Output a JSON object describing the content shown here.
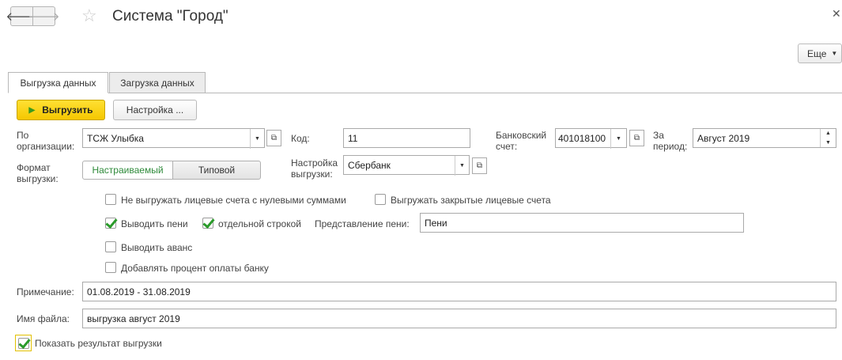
{
  "window": {
    "title": "Система \"Город\""
  },
  "header": {
    "more_label": "Еще"
  },
  "tabs": [
    {
      "label": "Выгрузка данных",
      "active": true
    },
    {
      "label": "Загрузка данных",
      "active": false
    }
  ],
  "toolbar": {
    "export_label": "Выгрузить",
    "settings_label": "Настройка ..."
  },
  "form": {
    "org_label_1": "По",
    "org_label_2": "организации:",
    "org_value": "ТСЖ Улыбка",
    "code_label": "Код:",
    "code_value": "11",
    "bank_label_1": "Банковский",
    "bank_label_2": "счет:",
    "bank_value": "401018100",
    "period_label_1": "За",
    "period_label_2": "период:",
    "period_value": "Август 2019",
    "format_label_1": "Формат",
    "format_label_2": "выгрузки:",
    "format_options": [
      "Настраиваемый",
      "Типовой"
    ],
    "format_selected": "Настраиваемый",
    "export_setting_label_1": "Настройка",
    "export_setting_label_2": "выгрузки:",
    "export_setting_value": "Сбербанк"
  },
  "checkboxes": {
    "skip_zero": {
      "label": "Не выгружать лицевые счета с нулевыми суммами",
      "checked": false
    },
    "export_closed": {
      "label": "Выгружать закрытые лицевые счета",
      "checked": false
    },
    "show_penalty": {
      "label": "Выводить пени",
      "checked": true
    },
    "separate_line": {
      "label": "отдельной строкой",
      "checked": true
    },
    "show_advance": {
      "label": "Выводить аванс",
      "checked": false
    },
    "add_bank_percent": {
      "label": "Добавлять процент оплаты банку",
      "checked": false
    },
    "show_result": {
      "label": "Показать результат выгрузки",
      "checked": true
    }
  },
  "penalty_repr": {
    "label": "Представление пени:",
    "value": "Пени"
  },
  "note": {
    "label": "Примечание:",
    "value": "01.08.2019 - 31.08.2019"
  },
  "filename": {
    "label": "Имя файла:",
    "value": "выгрузка август 2019"
  },
  "colors": {
    "accent_yellow": "#f5c700",
    "check_green": "#2a9a2a",
    "segment_green": "#2e8a3a"
  }
}
